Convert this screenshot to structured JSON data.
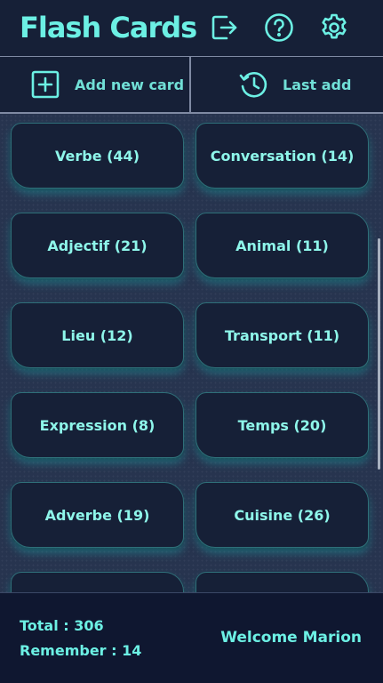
{
  "header": {
    "title": "Flash Cards",
    "icons": [
      "logout-icon",
      "help-icon",
      "gear-icon"
    ]
  },
  "toolbar": {
    "add_label": "Add new card",
    "last_label": "Last add"
  },
  "cards": [
    {
      "label": "Verbe (44)"
    },
    {
      "label": "Conversation (14)"
    },
    {
      "label": "Adjectif (21)"
    },
    {
      "label": "Animal (11)"
    },
    {
      "label": "Lieu (12)"
    },
    {
      "label": "Transport (11)"
    },
    {
      "label": "Expression (8)"
    },
    {
      "label": "Temps (20)"
    },
    {
      "label": "Adverbe (19)"
    },
    {
      "label": "Cuisine (26)"
    },
    {
      "label": ""
    },
    {
      "label": ""
    }
  ],
  "footer": {
    "total": "Total : 306",
    "remember": "Remember : 14",
    "welcome": "Welcome Marion"
  },
  "colors": {
    "accent": "#6cf0e4",
    "background": "#162037",
    "grid_background": "#27344f",
    "footer": "#0f1730"
  }
}
